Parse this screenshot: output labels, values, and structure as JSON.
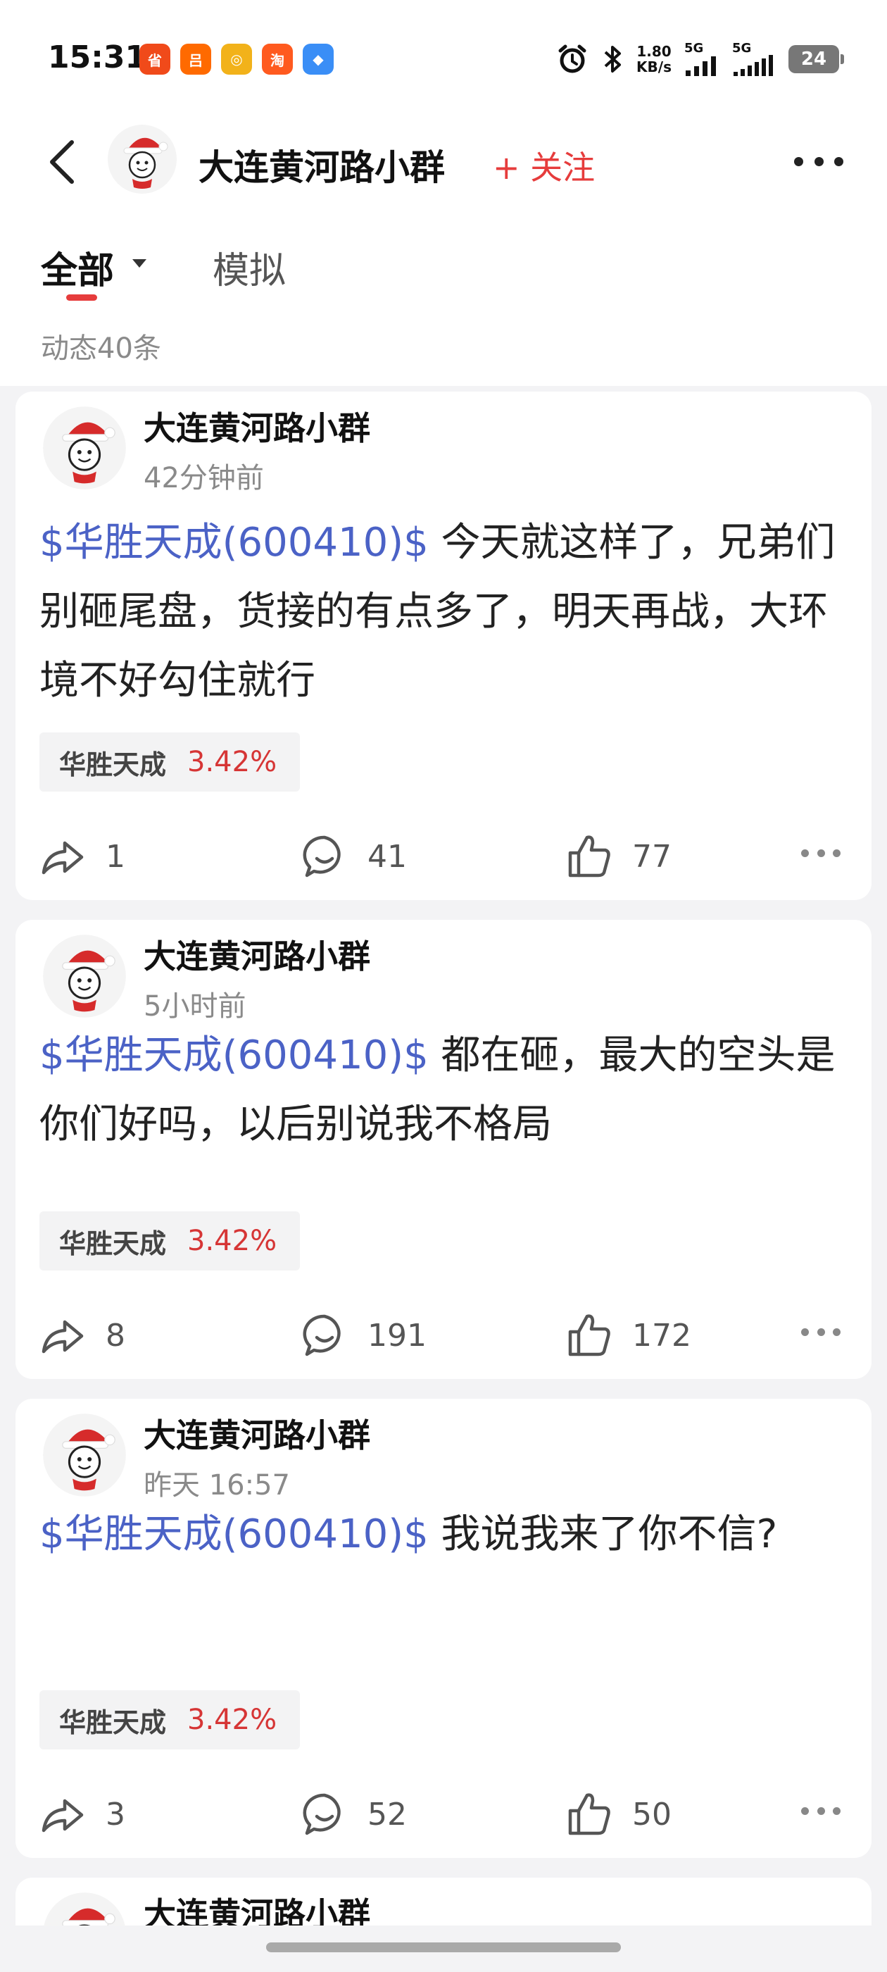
{
  "status_bar": {
    "time": "15:31",
    "app_icons": [
      {
        "name": "taobao-deals-icon",
        "text": "省",
        "color": "#f04a1a"
      },
      {
        "name": "orange-app-icon",
        "text": "吕",
        "color": "#ff6a00"
      },
      {
        "name": "lottery-app-icon",
        "text": "◎",
        "color": "#f2b21a"
      },
      {
        "name": "taobao-icon",
        "text": "淘",
        "color": "#ff5a1f"
      },
      {
        "name": "blue-app-icon",
        "text": "◆",
        "color": "#3a8ef6"
      }
    ],
    "net_speed": {
      "value": "1.80",
      "unit": "KB/s"
    },
    "signal1": "5G",
    "signal2": "5G",
    "battery": "24"
  },
  "header": {
    "title": "大连黄河路小群",
    "follow_label": "+ 关注"
  },
  "tabs": {
    "all": "全部",
    "simulated": "模拟"
  },
  "post_count": "动态40条",
  "accent_colors": {
    "red": "#e63c3c",
    "link_blue": "#4b62c6"
  },
  "posts": [
    {
      "author": "大连黄河路小群",
      "time": "42分钟前",
      "tag": "$华胜天成(600410)$",
      "text": " 今天就这样了，兄弟们别砸尾盘，货接的有点多了，明天再战，大环境不好勾住就行",
      "stock_name": "华胜天成",
      "stock_change": "3.42%",
      "shares": "1",
      "comments": "41",
      "likes": "77"
    },
    {
      "author": "大连黄河路小群",
      "time": "5小时前",
      "tag": "$华胜天成(600410)$",
      "text": " 都在砸，最大的空头是你们好吗，以后别说我不格局",
      "stock_name": "华胜天成",
      "stock_change": "3.42%",
      "shares": "8",
      "comments": "191",
      "likes": "172"
    },
    {
      "author": "大连黄河路小群",
      "time": "昨天 16:57",
      "tag": "$华胜天成(600410)$",
      "text": " 我说我来了你不信?",
      "stock_name": "华胜天成",
      "stock_change": "3.42%",
      "shares": "3",
      "comments": "52",
      "likes": "50"
    },
    {
      "author": "大连黄河路小群"
    }
  ]
}
